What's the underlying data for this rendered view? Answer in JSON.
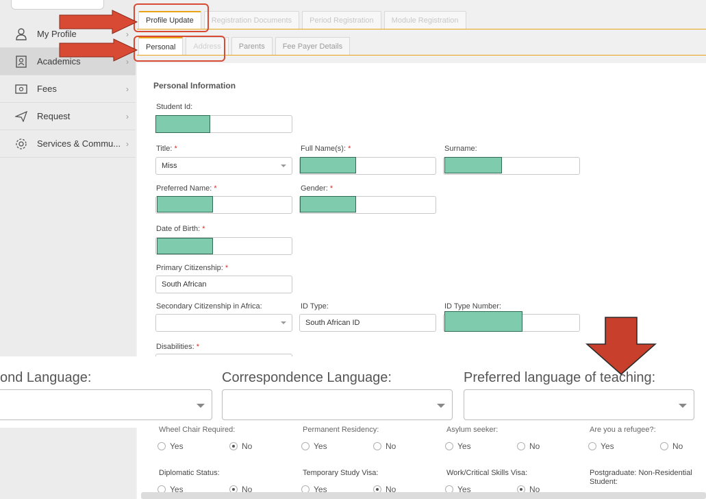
{
  "sidebar": {
    "items": [
      {
        "label": "My Profile",
        "icon": "person-icon"
      },
      {
        "label": "Academics",
        "icon": "id-badge-icon"
      },
      {
        "label": "Fees",
        "icon": "money-icon"
      },
      {
        "label": "Request",
        "icon": "send-icon"
      },
      {
        "label": "Services & Commu...",
        "icon": "gear-icon"
      }
    ]
  },
  "tabs": {
    "main": [
      "Profile Update",
      "Registration Documents",
      "Period Registration",
      "Module Registration"
    ],
    "sub": [
      "Personal",
      "Address",
      "Parents",
      "Fee Payer Details"
    ]
  },
  "form": {
    "section_title": "Personal Information",
    "student_id_label": "Student Id:",
    "title_label": "Title:",
    "title_value": "Miss",
    "fullnames_label": "Full Name(s):",
    "surname_label": "Surname:",
    "preferred_label": "Preferred Name:",
    "gender_label": "Gender:",
    "dob_label": "Date of Birth:",
    "primary_cit_label": "Primary Citizenship:",
    "primary_cit_value": "South African",
    "secondary_cit_label": "Secondary Citizenship in Africa:",
    "id_type_label": "ID Type:",
    "id_type_value": "South African ID",
    "id_number_label": "ID Type Number:",
    "disabilities_label": "Disabilities:",
    "required_mark": "*"
  },
  "languages": {
    "second": "ond Language:",
    "correspondence": "Correspondence Language:",
    "teaching": "Preferred language of teaching:"
  },
  "lower": {
    "row1": [
      "Wheel Chair Required:",
      "Permanent Residency:",
      "Asylum seeker:",
      "Are you a refugee?:"
    ],
    "row2": [
      "Diplomatic Status:",
      "Temporary Study Visa:",
      "Work/Critical Skills Visa:",
      "Postgraduate: Non-Residential Student:"
    ],
    "yes": "Yes",
    "no": "No"
  },
  "colors": {
    "accent": "#e8a317",
    "annotation": "#d84a33",
    "redaction": "#7fcbad"
  }
}
